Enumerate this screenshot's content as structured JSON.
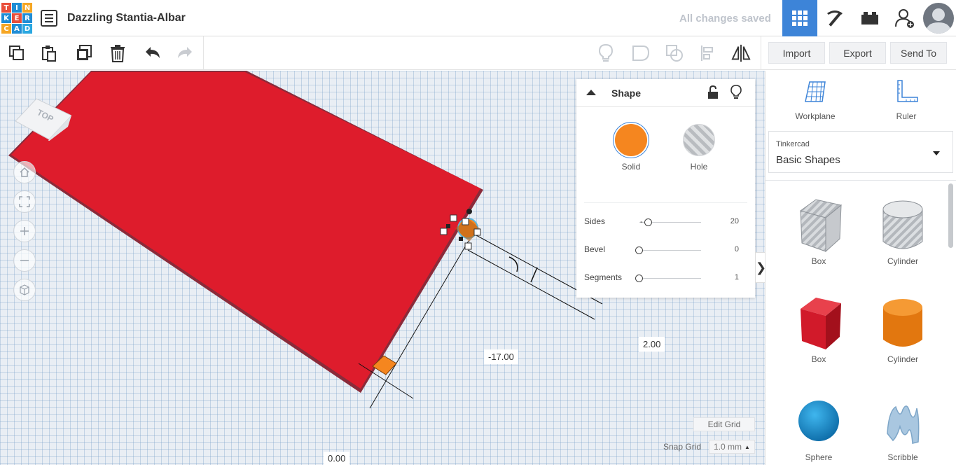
{
  "app": {
    "logo_letters": [
      "T",
      "I",
      "N",
      "K",
      "E",
      "R",
      "C",
      "A",
      "D"
    ],
    "logo_colors": [
      "#e94f3b",
      "#1f8dd6",
      "#f6a623",
      "#1f8dd6",
      "#e94f3b",
      "#1f8dd6",
      "#f6a623",
      "#1f8dd6",
      "#2aa7e0"
    ],
    "title": "Dazzling Stantia-Albar",
    "save_status": "All changes saved"
  },
  "toolbar": {
    "import_label": "Import",
    "export_label": "Export",
    "send_to_label": "Send To"
  },
  "viewcube": {
    "face_label": "TOP"
  },
  "dimensions": {
    "depth_label": "-17.00",
    "height_label": "2.00",
    "origin_label": "0.00"
  },
  "shape_panel": {
    "title": "Shape",
    "solid_label": "Solid",
    "hole_label": "Hole",
    "solid_color": "#f5861f",
    "properties": [
      {
        "label": "Sides",
        "value": "20"
      },
      {
        "label": "Bevel",
        "value": "0"
      },
      {
        "label": "Segments",
        "value": "1"
      }
    ]
  },
  "grid": {
    "edit_label": "Edit Grid",
    "snap_label": "Snap Grid",
    "snap_value": "1.0 mm"
  },
  "sidebar": {
    "workplane_label": "Workplane",
    "ruler_label": "Ruler",
    "library_source": "Tinkercad",
    "library_name": "Basic Shapes",
    "shapes": [
      {
        "label": "Box"
      },
      {
        "label": "Cylinder"
      },
      {
        "label": "Box"
      },
      {
        "label": "Cylinder"
      },
      {
        "label": "Sphere"
      },
      {
        "label": "Scribble"
      }
    ]
  },
  "colors": {
    "accent": "#3d84d8",
    "workplane_shape": "#de1c2c",
    "selection": "#f5861f"
  }
}
